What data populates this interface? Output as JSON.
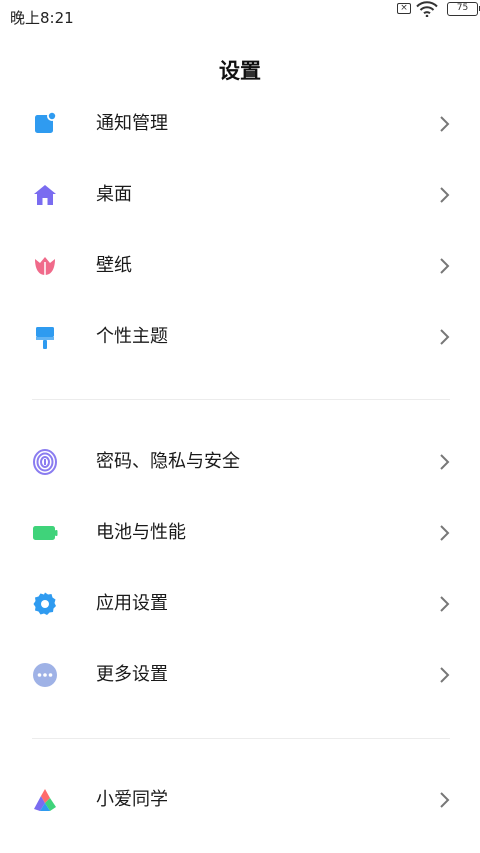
{
  "status_bar": {
    "time": "晚上8:21",
    "battery": "75",
    "icons": [
      "sim-disabled-icon",
      "wifi-icon",
      "battery-icon"
    ]
  },
  "page": {
    "title": "设置"
  },
  "groups": [
    {
      "items": [
        {
          "label": "通知管理",
          "icon": "notification-icon",
          "color": "#2f9bf0"
        },
        {
          "label": "桌面",
          "icon": "home-icon",
          "color": "#7a6cf0"
        },
        {
          "label": "壁纸",
          "icon": "tulip-icon",
          "color": "#f06a8a"
        },
        {
          "label": "个性主题",
          "icon": "brush-icon",
          "color": "#2f9bf0"
        }
      ]
    },
    {
      "items": [
        {
          "label": "密码、隐私与安全",
          "icon": "fingerprint-icon",
          "color": "#8a7cf0"
        },
        {
          "label": "电池与性能",
          "icon": "battery-icon",
          "color": "#3fd37a"
        },
        {
          "label": "应用设置",
          "icon": "gear-icon",
          "color": "#2f9bf0"
        },
        {
          "label": "更多设置",
          "icon": "more-icon",
          "color": "#9fb2e6"
        }
      ]
    },
    {
      "items": [
        {
          "label": "小爱同学",
          "icon": "xiaoai-icon",
          "color": "#ff6b6b"
        }
      ]
    }
  ]
}
